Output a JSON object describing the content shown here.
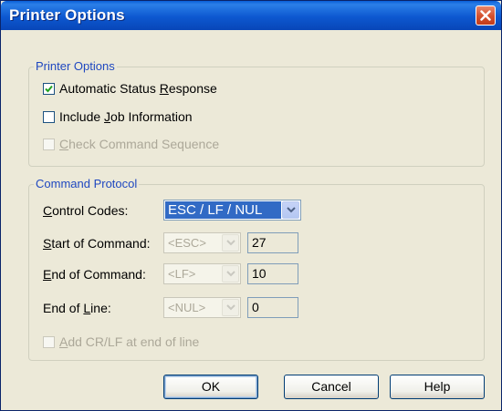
{
  "window": {
    "title": "Printer Options",
    "close_icon": "close-icon"
  },
  "printer_options": {
    "legend": "Printer Options",
    "automatic_status": {
      "label_pre": "Automatic Status ",
      "label_key": "R",
      "label_post": "esponse",
      "checked": true
    },
    "include_job": {
      "label_pre": "Include ",
      "label_key": "J",
      "label_post": "ob Information",
      "checked": false
    },
    "check_command": {
      "label_pre": "",
      "label_key": "C",
      "label_post": "heck Command Sequence",
      "checked": false,
      "enabled": false
    }
  },
  "command_protocol": {
    "legend": "Command Protocol",
    "control_codes": {
      "label_key": "C",
      "label_post": "ontrol Codes:",
      "value": "ESC / LF / NUL"
    },
    "start_of_command": {
      "label_key": "S",
      "label_post": "tart of Command:",
      "combo": "<ESC>",
      "code": "27"
    },
    "end_of_command": {
      "label_key": "E",
      "label_post": "nd of Command:",
      "combo": "<LF>",
      "code": "10"
    },
    "end_of_line": {
      "label_pre": "End of ",
      "label_key": "L",
      "label_post": "ine:",
      "combo": "<NUL>",
      "code": "0"
    },
    "add_crlf": {
      "label_key": "A",
      "label_post": "dd CR/LF at end of line",
      "checked": false,
      "enabled": false
    }
  },
  "buttons": {
    "ok": "OK",
    "cancel": "Cancel",
    "help": "Help"
  }
}
